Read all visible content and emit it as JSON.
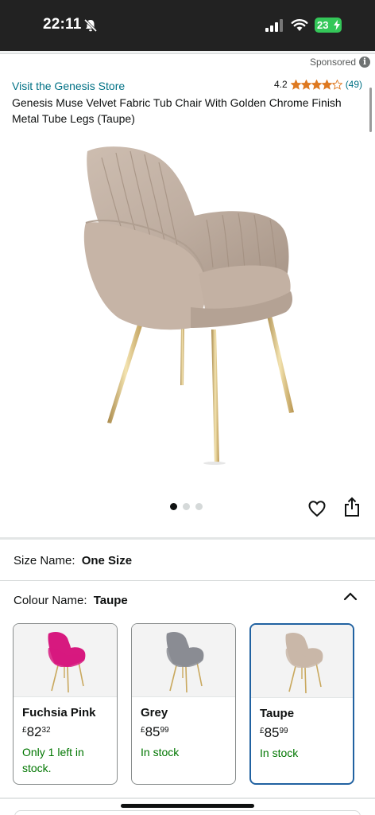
{
  "status_bar": {
    "time": "22:11",
    "battery": "23"
  },
  "sponsored": {
    "label": "Sponsored",
    "info_glyph": "i"
  },
  "product": {
    "store_link": "Visit the Genesis Store",
    "rating_value": "4.2",
    "rating_stars": 4.2,
    "rating_count": "(49)",
    "title": "Genesis Muse Velvet Fabric Tub Chair With Golden Chrome Finish Metal Tube Legs (Taupe)",
    "image_count": 3,
    "active_image": 1
  },
  "size": {
    "label": "Size Name:",
    "value": "One Size"
  },
  "colour": {
    "label": "Colour Name:",
    "value": "Taupe",
    "options": [
      {
        "name": "Fuchsia Pink",
        "currency": "£",
        "price_whole": "82",
        "price_fraction": "32",
        "availability": "Only 1 left in stock.",
        "seat_color": "#d7197f",
        "selected": false
      },
      {
        "name": "Grey",
        "currency": "£",
        "price_whole": "85",
        "price_fraction": "99",
        "availability": "In stock",
        "seat_color": "#8a8c93",
        "selected": false
      },
      {
        "name": "Taupe",
        "currency": "£",
        "price_whole": "85",
        "price_fraction": "99",
        "availability": "In stock",
        "seat_color": "#c9b7a8",
        "selected": true
      }
    ]
  },
  "colors": {
    "link": "#007185",
    "star": "#de7921",
    "in_stock": "#007600",
    "selected_border": "#2162a1"
  },
  "icons": {
    "bell": "bell-slash-icon",
    "signal": "cellular-signal-icon",
    "wifi": "wifi-icon",
    "heart": "heart-icon",
    "share": "share-icon",
    "chevron": "chevron-up-icon"
  }
}
